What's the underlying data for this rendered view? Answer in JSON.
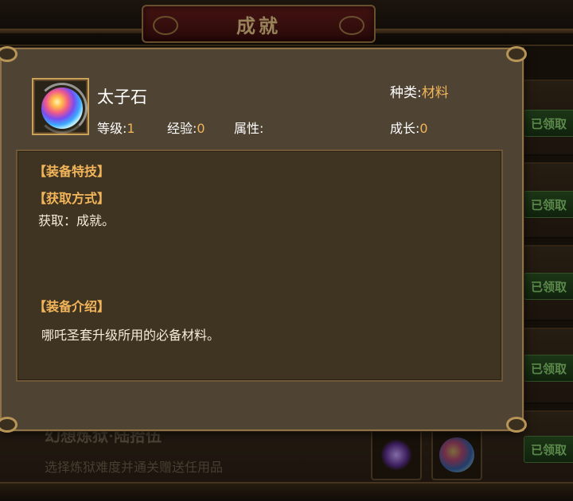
{
  "header": {
    "title": "成就"
  },
  "background_list": {
    "claimed_label": "已领取",
    "bottom_item": {
      "title": "幻想炼狱·陆拾伍",
      "desc": "选择炼狱难度并通关赠送任用品"
    }
  },
  "item_panel": {
    "name": "太子石",
    "icon": "rainbow-gem-icon",
    "type_label": "种类:",
    "type_value": "材料",
    "level_label": "等级:",
    "level_value": "1",
    "exp_label": "经验:",
    "exp_value": "0",
    "attr_label": "属性:",
    "attr_value": "",
    "growth_label": "成长:",
    "growth_value": "0",
    "sections": {
      "skill_title": "【装备特技】",
      "obtain_title": "【获取方式】",
      "obtain_body": "获取：成就。",
      "intro_title": "【装备介绍】",
      "intro_body": "哪吒圣套升级所用的必备材料。"
    }
  },
  "colors": {
    "accent": "#f2b55a",
    "panel_bg": "#4f4333",
    "claimed_green": "#8cd274"
  }
}
